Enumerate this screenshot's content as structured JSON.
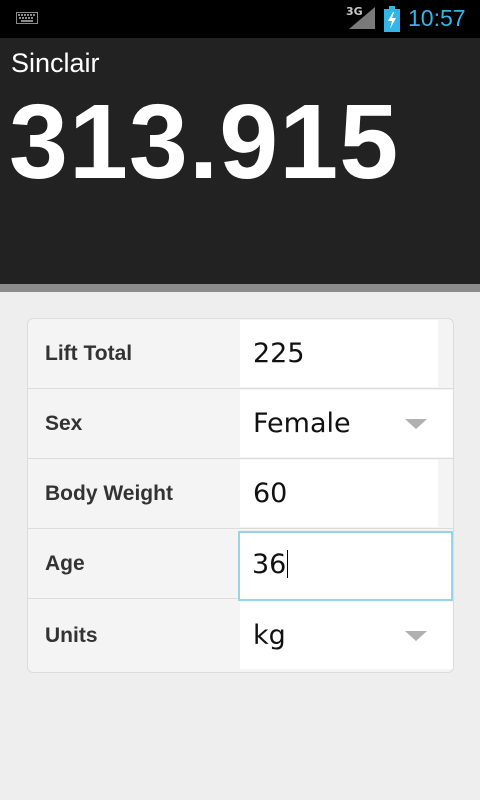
{
  "status_bar": {
    "network": "3G",
    "time": "10:57",
    "icons": [
      "keyboard-icon",
      "signal-icon",
      "battery-charging-icon"
    ],
    "time_color": "#33b5e5"
  },
  "header": {
    "title": "Sinclair",
    "value": "313.915"
  },
  "form": {
    "lift_total": {
      "label": "Lift Total",
      "value": "225"
    },
    "sex": {
      "label": "Sex",
      "value": "Female"
    },
    "body_weight": {
      "label": "Body Weight",
      "value": "60"
    },
    "age": {
      "label": "Age",
      "value": "36"
    },
    "units": {
      "label": "Units",
      "value": "kg"
    }
  }
}
